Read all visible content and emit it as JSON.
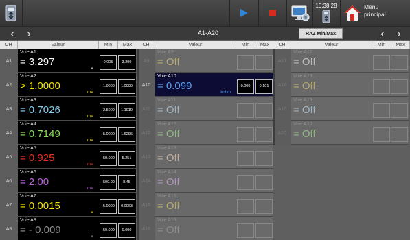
{
  "toolbar": {
    "clock_time": "10:38:28",
    "menu_label": "Menu principal",
    "play_color": "#2f86d8",
    "record_color": "#d82a1e"
  },
  "nav": {
    "range_title": "A1-A20",
    "raz_button": "RAZ Min/Max"
  },
  "headers": {
    "ch": "CH",
    "valeur": "Valeur",
    "min": "Min",
    "max": "Max"
  },
  "columns": [
    {
      "channels": [
        {
          "ch": "A1",
          "name": "Voie A1",
          "prefix": "=",
          "value": "3.297",
          "unit": "V",
          "min": "0.005",
          "max": "3.299",
          "color": "#ffffff",
          "unit_color": "#ffffff",
          "active": true
        },
        {
          "ch": "A2",
          "name": "Voie A2",
          "prefix": ">",
          "value": "1.0000",
          "unit": "mV",
          "min": "-1.0000",
          "max": "1.0000",
          "color": "#f2e200",
          "unit_color": "#f2e200",
          "active": true
        },
        {
          "ch": "A3",
          "name": "Voie A3",
          "prefix": "=",
          "value": "0.7026",
          "unit": "mV",
          "min": "-2.5000",
          "max": "1.1919",
          "color": "#7fd0f2",
          "unit_color": "#f2e200",
          "active": true
        },
        {
          "ch": "A4",
          "name": "Voie A4",
          "prefix": "=",
          "value": "0.7149",
          "unit": "mV",
          "min": "-5.0000",
          "max": "1.6296",
          "color": "#86dd55",
          "unit_color": "#f2e200",
          "active": true
        },
        {
          "ch": "A5",
          "name": "Voie A5",
          "prefix": "=",
          "value": "0.925",
          "unit": "mV",
          "min": "-50.000",
          "max": "5.251",
          "color": "#e8302a",
          "unit_color": "#e8302a",
          "active": true
        },
        {
          "ch": "A6",
          "name": "Voie A6",
          "prefix": "=",
          "value": "2.00",
          "unit": "mV",
          "min": "-500.00",
          "max": "8.45",
          "color": "#c35ee8",
          "unit_color": "#c35ee8",
          "active": true
        },
        {
          "ch": "A7",
          "name": "Voie A7",
          "prefix": "=",
          "value": "0.0015",
          "unit": "V",
          "min": "-5.0000",
          "max": "0.0063",
          "color": "#f2e200",
          "unit_color": "#f2e200",
          "active": true
        },
        {
          "ch": "A8",
          "name": "Voie A8",
          "prefix": "=",
          "value": "- 0.009",
          "unit": "V",
          "min": "-50.000",
          "max": "0.000",
          "color": "#8a8a8a",
          "unit_color": "#9a9a9a",
          "active": true
        }
      ]
    },
    {
      "channels": [
        {
          "ch": "A9",
          "name": "Voie A9",
          "prefix": "=",
          "value": "Off",
          "unit": "",
          "min": "",
          "max": "",
          "color": "#d2c27a",
          "active": false
        },
        {
          "ch": "A10",
          "name": "Voie A10",
          "prefix": "=",
          "value": "0.099",
          "unit": "kohm",
          "min": "0.000",
          "max": "0.101",
          "color": "#5a9ef0",
          "unit_color": "#5a9ef0",
          "active": true
        },
        {
          "ch": "A11",
          "name": "Voie A11",
          "prefix": "=",
          "value": "Off",
          "unit": "",
          "min": "",
          "max": "",
          "color": "#b6cfe0",
          "active": false
        },
        {
          "ch": "A12",
          "name": "Voie A12",
          "prefix": "=",
          "value": "Off",
          "unit": "",
          "min": "",
          "max": "",
          "color": "#9ed28e",
          "active": false
        },
        {
          "ch": "A13",
          "name": "Voie A13",
          "prefix": "=",
          "value": "Off",
          "unit": "",
          "min": "",
          "max": "",
          "color": "#dcc6ae",
          "active": false
        },
        {
          "ch": "A14",
          "name": "Voie A14",
          "prefix": "=",
          "value": "Off",
          "unit": "",
          "min": "",
          "max": "",
          "color": "#c6a4d6",
          "active": false
        },
        {
          "ch": "A15",
          "name": "Voie A15",
          "prefix": "=",
          "value": "Off",
          "unit": "",
          "min": "",
          "max": "",
          "color": "#d2c27a",
          "active": false
        },
        {
          "ch": "A16",
          "name": "Voie A16",
          "prefix": "=",
          "value": "Off",
          "unit": "",
          "min": "",
          "max": "",
          "color": "#9a9a9a",
          "active": false
        }
      ]
    },
    {
      "channels": [
        {
          "ch": "A17",
          "name": "Voie A17",
          "prefix": "=",
          "value": "Off",
          "unit": "",
          "min": "",
          "max": "",
          "color": "#d8d8d8",
          "active": false
        },
        {
          "ch": "A18",
          "name": "Voie A18",
          "prefix": "=",
          "value": "Off",
          "unit": "",
          "min": "",
          "max": "",
          "color": "#d2c27a",
          "active": false
        },
        {
          "ch": "A19",
          "name": "Voie A19",
          "prefix": "=",
          "value": "Off",
          "unit": "",
          "min": "",
          "max": "",
          "color": "#b6cfe0",
          "active": false
        },
        {
          "ch": "A20",
          "name": "Voie A20",
          "prefix": "=",
          "value": "Off",
          "unit": "",
          "min": "",
          "max": "",
          "color": "#9ed28e",
          "active": false
        }
      ]
    }
  ]
}
